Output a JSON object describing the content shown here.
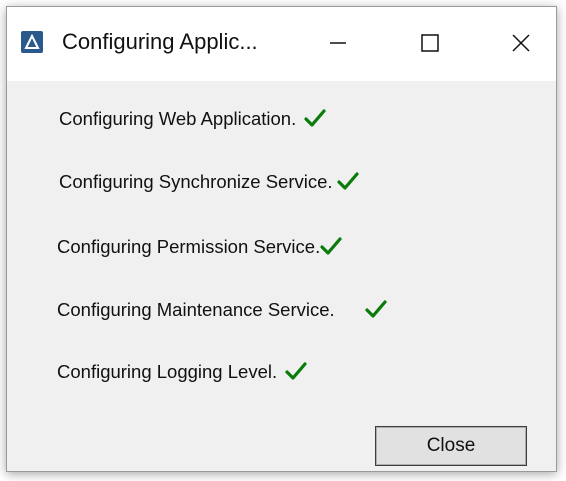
{
  "window": {
    "title": "Configuring Applic..."
  },
  "icons": {
    "app": "app-logo-icon",
    "minimize": "minimize-icon",
    "maximize": "maximize-icon",
    "close": "close-icon",
    "check": "checkmark-icon"
  },
  "colors": {
    "check": "#0a7a0a",
    "app_icon": "#2a5a8c"
  },
  "steps": [
    {
      "label": "Configuring Web Application.",
      "status": "done"
    },
    {
      "label": "Configuring Synchronize Service.",
      "status": "done"
    },
    {
      "label": "Configuring Permission Service.",
      "status": "done"
    },
    {
      "label": "Configuring Maintenance Service.",
      "status": "done"
    },
    {
      "label": "Configuring Logging Level.",
      "status": "done"
    }
  ],
  "buttons": {
    "close_label": "Close"
  }
}
